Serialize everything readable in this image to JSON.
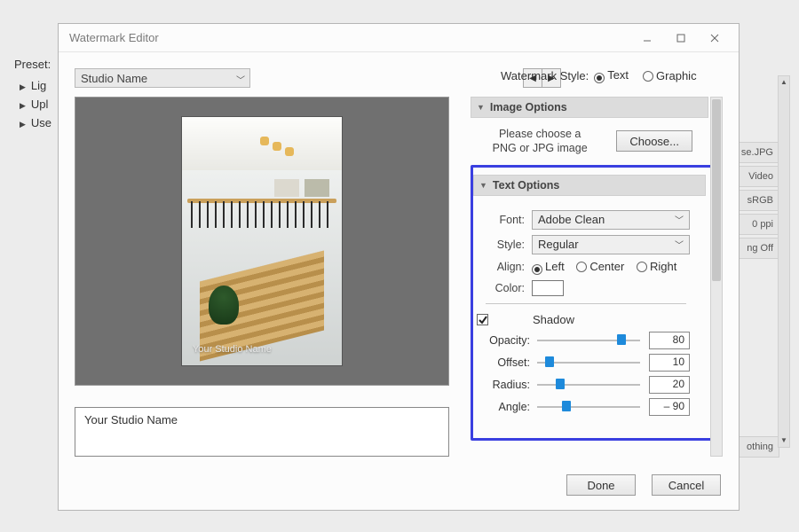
{
  "bg": {
    "preset_label": "Preset:",
    "items": [
      "Lig",
      "Upl",
      "Use"
    ],
    "right_chips": [
      "se.JPG",
      "Video",
      "sRGB",
      "0 ppi",
      "ng Off",
      "othing"
    ]
  },
  "dialog": {
    "title": "Watermark Editor",
    "preset_selected": "Studio Name",
    "ws_label": "Watermark Style:",
    "ws_text": "Text",
    "ws_graphic": "Graphic",
    "preview_wm": "Your Studio Name",
    "name_input": "Your Studio Name",
    "done": "Done",
    "cancel": "Cancel"
  },
  "image_options": {
    "header": "Image Options",
    "msg_l1": "Please choose a",
    "msg_l2": "PNG or JPG image",
    "choose": "Choose..."
  },
  "text_options": {
    "header": "Text Options",
    "font_label": "Font:",
    "font_value": "Adobe Clean",
    "style_label": "Style:",
    "style_value": "Regular",
    "align_label": "Align:",
    "align_left": "Left",
    "align_center": "Center",
    "align_right": "Right",
    "color_label": "Color:",
    "shadow_label": "Shadow",
    "opacity_label": "Opacity:",
    "opacity_value": "80",
    "offset_label": "Offset:",
    "offset_value": "10",
    "radius_label": "Radius:",
    "radius_value": "20",
    "angle_label": "Angle:",
    "angle_value": "– 90"
  }
}
